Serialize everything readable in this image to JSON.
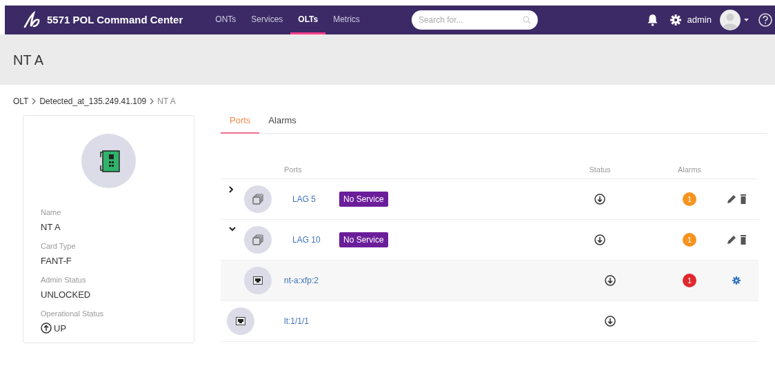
{
  "navbar": {
    "app_title": "5571 POL Command Center",
    "links": [
      {
        "label": "ONTs",
        "selected": false
      },
      {
        "label": "Services",
        "selected": false
      },
      {
        "label": "OLTs",
        "selected": true
      },
      {
        "label": "Metrics",
        "selected": false
      }
    ],
    "search": {
      "placeholder": "Search for..."
    },
    "user": "admin"
  },
  "page_title": "NT A",
  "breadcrumb": [
    {
      "label": "OLT",
      "current": false
    },
    {
      "label": "Detected_at_135.249.41.109",
      "current": false
    },
    {
      "label": "NT A",
      "current": true
    }
  ],
  "card": {
    "fields": [
      {
        "label": "Name",
        "value": "NT A"
      },
      {
        "label": "Card Type",
        "value": "FANT-F"
      },
      {
        "label": "Admin Status",
        "value": "UNLOCKED"
      },
      {
        "label": "Operational Status",
        "value": "UP",
        "up": true
      }
    ]
  },
  "tabs": [
    {
      "label": "Ports",
      "selected": true
    },
    {
      "label": "Alarms",
      "selected": false
    }
  ],
  "table": {
    "columns": [
      "Ports",
      "Status",
      "Alarms"
    ],
    "rows": [
      {
        "kind": "lag",
        "name": "LAG 5",
        "badge": "No Service",
        "expanded": false,
        "up": false,
        "alarms": "1",
        "color": "#f7931e",
        "editable": true,
        "deletable": true
      },
      {
        "kind": "lag",
        "name": "LAG 10",
        "badge": "No Service",
        "expanded": true,
        "up": false,
        "alarms": "1",
        "color": "#f7931e",
        "editable": true,
        "deletable": true,
        "children": [
          {
            "kind": "port",
            "name": "nt-a:xfp:2",
            "up": false,
            "alarms": "1",
            "color": "#e0282e",
            "configurable": true
          }
        ]
      },
      {
        "kind": "port",
        "name": "lt:1/1/1",
        "up": false
      }
    ]
  }
}
